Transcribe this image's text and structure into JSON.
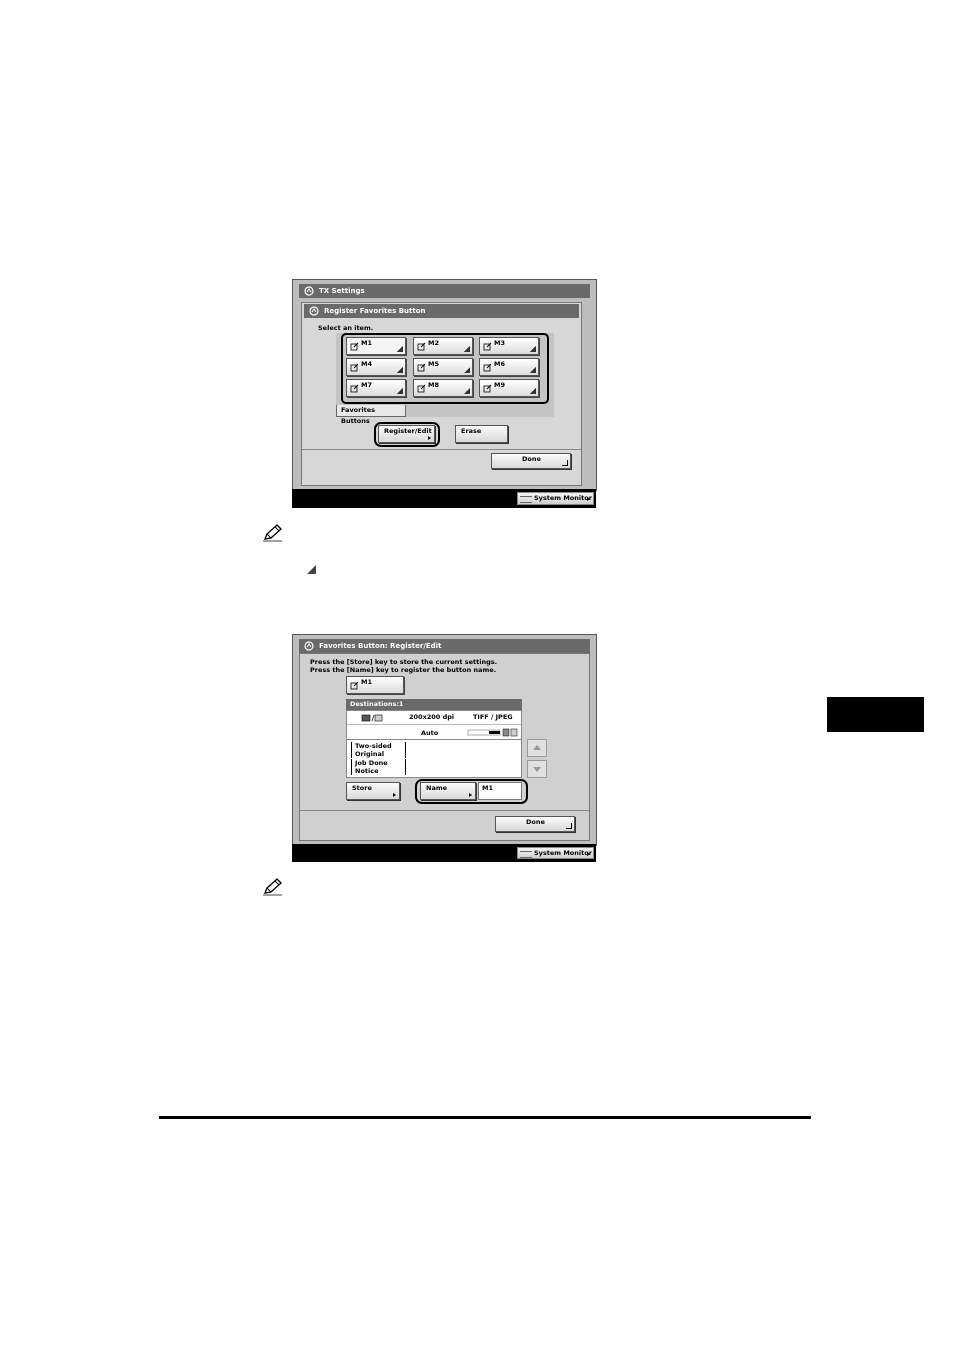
{
  "screen1": {
    "window_title": "TX Settings",
    "dialog_title": "Register Favorites Button",
    "instruction": "Select an item.",
    "favorites": [
      "M1",
      "M2",
      "M3",
      "M4",
      "M5",
      "M6",
      "M7",
      "M8",
      "M9"
    ],
    "tab_label": "Favorites Buttons",
    "register_edit_label": "Register/Edit",
    "erase_label": "Erase",
    "done_label": "Done",
    "system_monitor_label": "System Monitor"
  },
  "screen2": {
    "window_title": "Favorites Button: Register/Edit",
    "instruction_line1": "Press the [Store] key to store the current settings.",
    "instruction_line2": "Press the [Name] key to register the button name.",
    "button_label": "M1",
    "destinations_label": "Destinations:1",
    "resolution": "200x200 dpi",
    "file_format": "TIFF  / JPEG",
    "density": "Auto",
    "settings": [
      {
        "line1": "Two-sided",
        "line2": "Original"
      },
      {
        "line1": "Job Done",
        "line2": "Notice"
      }
    ],
    "store_label": "Store",
    "name_label": "Name",
    "name_value": "M1",
    "done_label": "Done",
    "system_monitor_label": "System Monitor"
  },
  "colors": {
    "screen_bg": "#bdbdbd",
    "title_bar": "#6a6a6a",
    "highlight": "#000000"
  }
}
